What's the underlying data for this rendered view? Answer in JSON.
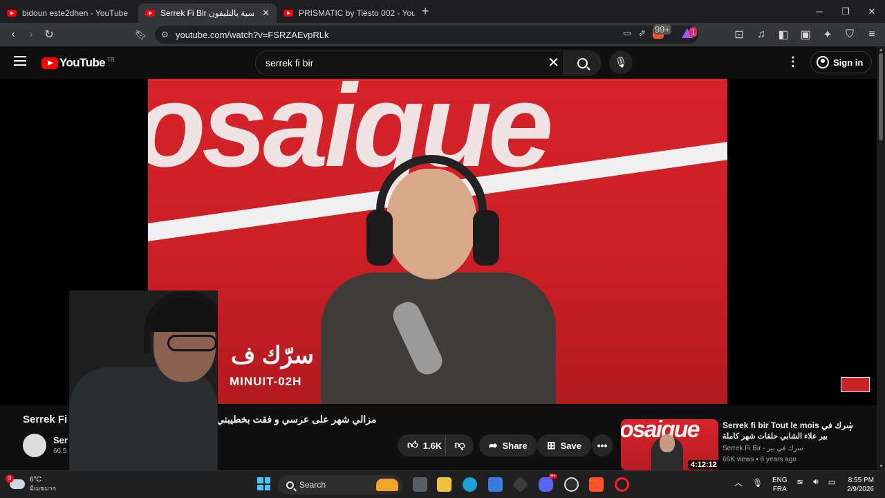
{
  "browser": {
    "tabs": [
      {
        "title": "bidoun este2dhen - YouTube",
        "active": false
      },
      {
        "title": "Serrek Fi Bir ﻻقات جنسية بالتليفون",
        "active": true
      },
      {
        "title": "PRISMATIC by Tiësto 002 - YouTube",
        "active": false
      }
    ],
    "new_tab": "+",
    "url": "youtube.com/watch?v=FSRZAEvpRLk",
    "brave_badge": "99+",
    "rewards_badge": "1"
  },
  "youtube": {
    "logo_text": "YouTube",
    "country_code": "TR",
    "search_value": "serrek fi bir",
    "sign_in": "Sign in"
  },
  "video": {
    "overlay_arabic": "سرّك ف",
    "overlay_latin": "MINUIT-02H",
    "title_latin": "Serrek Fi",
    "title_arabic": "مزالي شهر على عرسي و فقت بخطيبتي",
    "channel_name": "Ser",
    "subscribers": "66.5",
    "likes": "1.6K",
    "share_label": "Share",
    "save_label": "Save"
  },
  "recommendation": {
    "title_line1": "Serrek fi bir Tout le mois سرك في",
    "title_line2": "بير علاء الشابي حلقات شهر كاملة",
    "channel": "Serrek Fi Bir - سرك في بير",
    "meta": "66K views • 6 years ago",
    "duration": "4:12:12"
  },
  "taskbar": {
    "weather_temp": "6°C",
    "weather_condition": "มีเมฆมาก",
    "weather_badge": "3",
    "search_label": "Search",
    "lang_line1": "ENG",
    "lang_line2": "FRA",
    "time": "8:55 PM",
    "date": "2/9/2026",
    "discord_badge": "9+"
  }
}
